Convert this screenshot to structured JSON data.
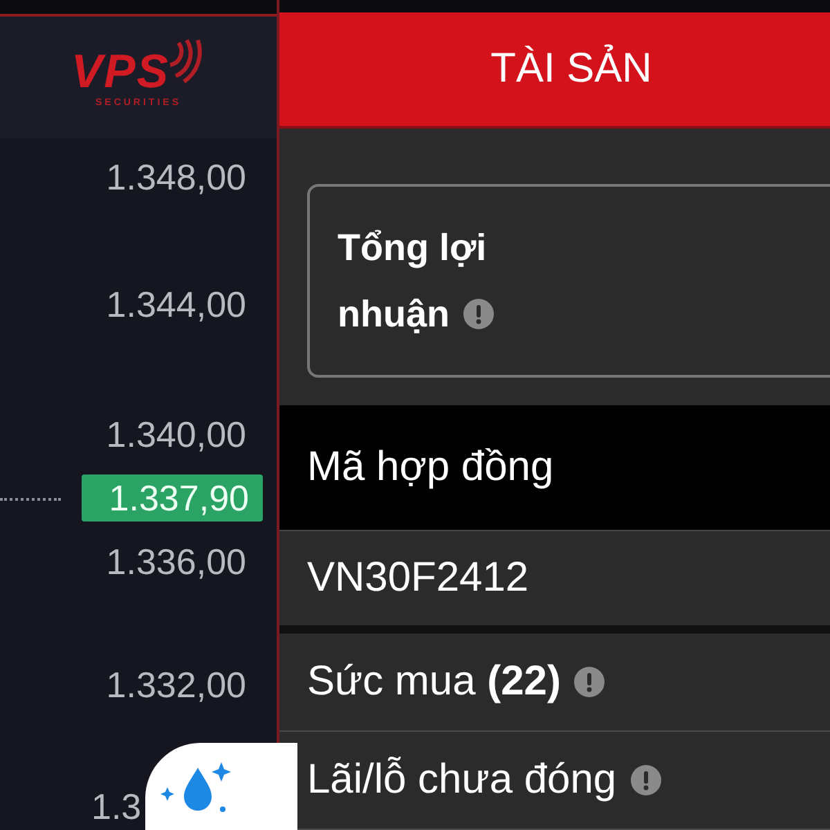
{
  "logo": {
    "brand": "VPS",
    "tagline": "SECURITIES"
  },
  "price_axis": {
    "labels": [
      {
        "text": "1.348,00"
      },
      {
        "text": "1.344,00"
      },
      {
        "text": "1.340,00"
      },
      {
        "text": "1.337,90",
        "kind": "current"
      },
      {
        "text": "1.336,00"
      },
      {
        "text": "1.332,00"
      },
      {
        "text": "1.3",
        "kind": "covered"
      }
    ]
  },
  "panel": {
    "title": "TÀI SẢN",
    "summary_card": {
      "label": "Tổng lợi nhuận"
    },
    "table_header": {
      "label": "Mã hợp đồng"
    },
    "contract": {
      "code": "VN30F2412"
    },
    "rows": [
      {
        "label": "Sức mua **(22)**",
        "info": true
      },
      {
        "label": "Lãi/lỗ chưa đóng",
        "info": true
      }
    ]
  }
}
